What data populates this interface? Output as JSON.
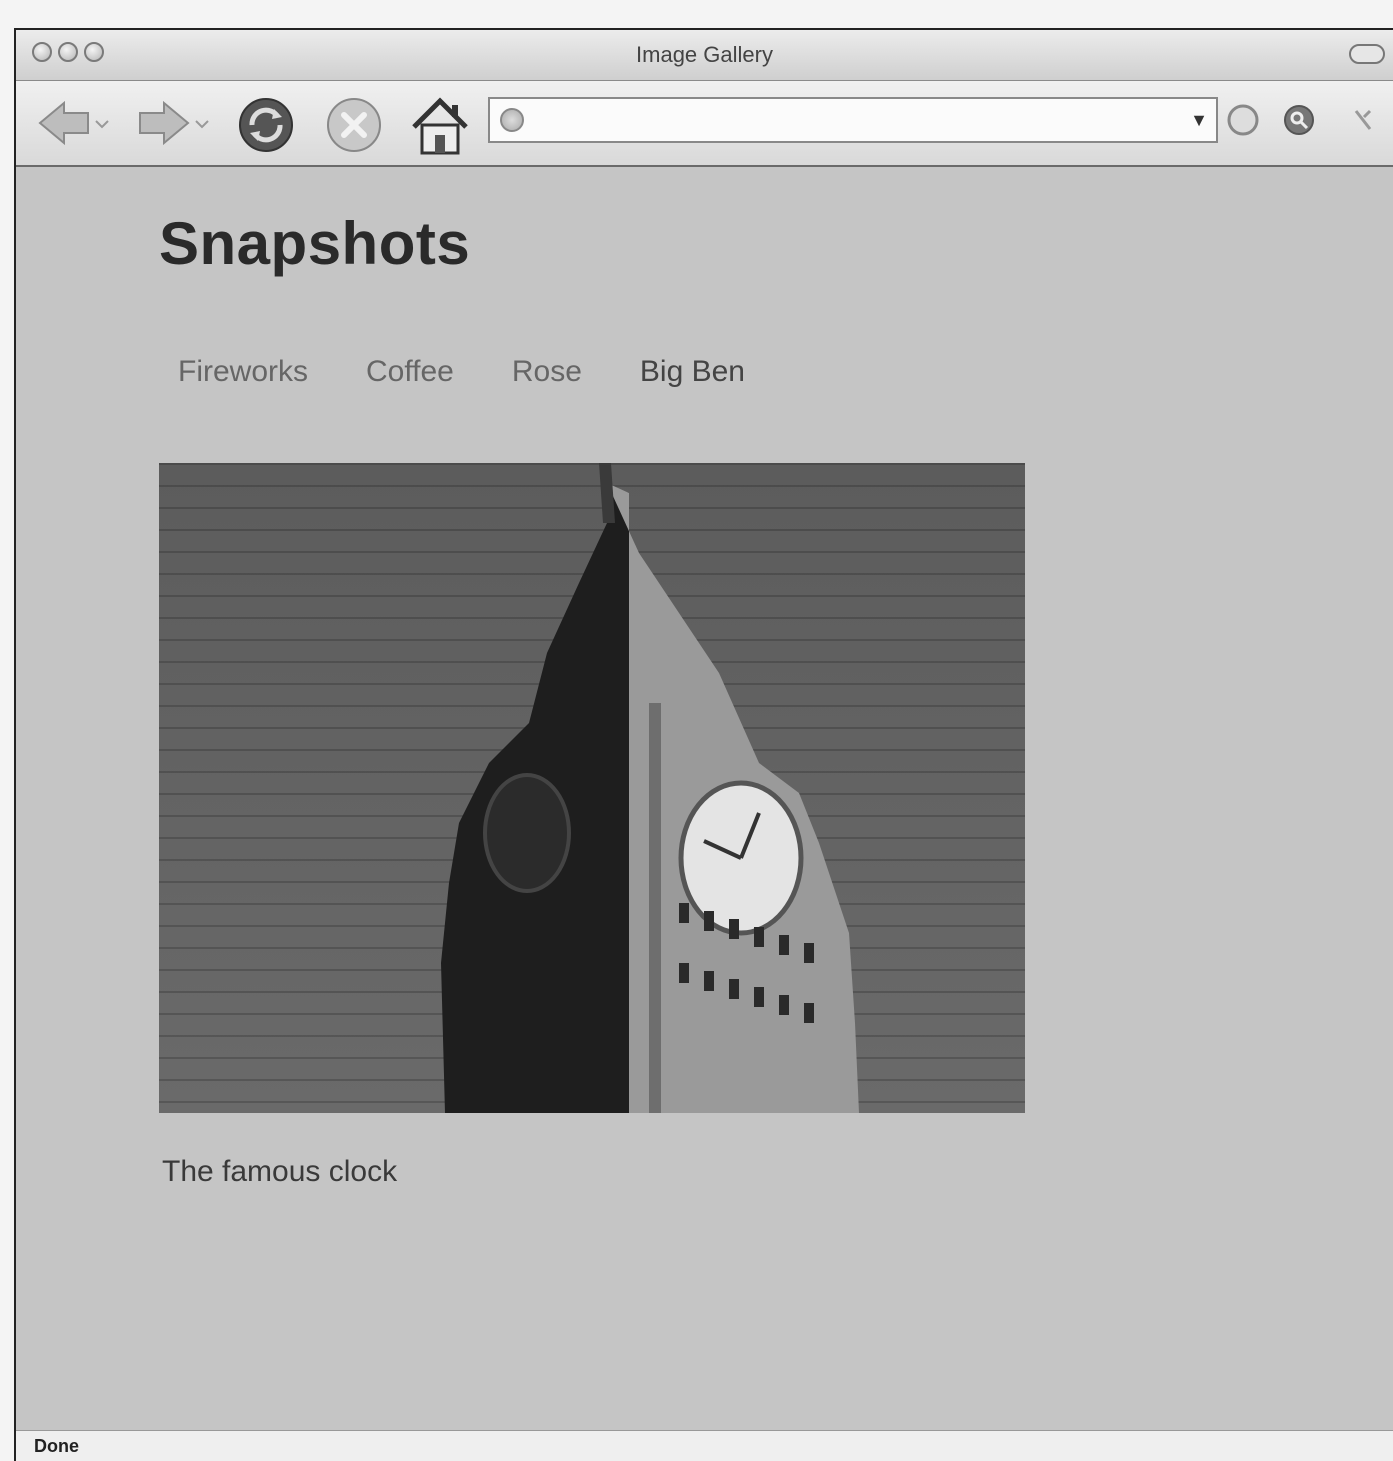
{
  "window": {
    "title": "Image Gallery"
  },
  "toolbar": {
    "back_icon": "back-arrow-icon",
    "forward_icon": "forward-arrow-icon",
    "reload_icon": "reload-icon",
    "stop_icon": "stop-icon",
    "home_icon": "home-icon",
    "url": ""
  },
  "page": {
    "heading": "Snapshots",
    "links": [
      {
        "label": "Fireworks"
      },
      {
        "label": "Coffee"
      },
      {
        "label": "Rose"
      },
      {
        "label": "Big Ben"
      }
    ],
    "active_link": "Big Ben",
    "description": "The famous clock"
  },
  "status": {
    "text": "Done"
  }
}
